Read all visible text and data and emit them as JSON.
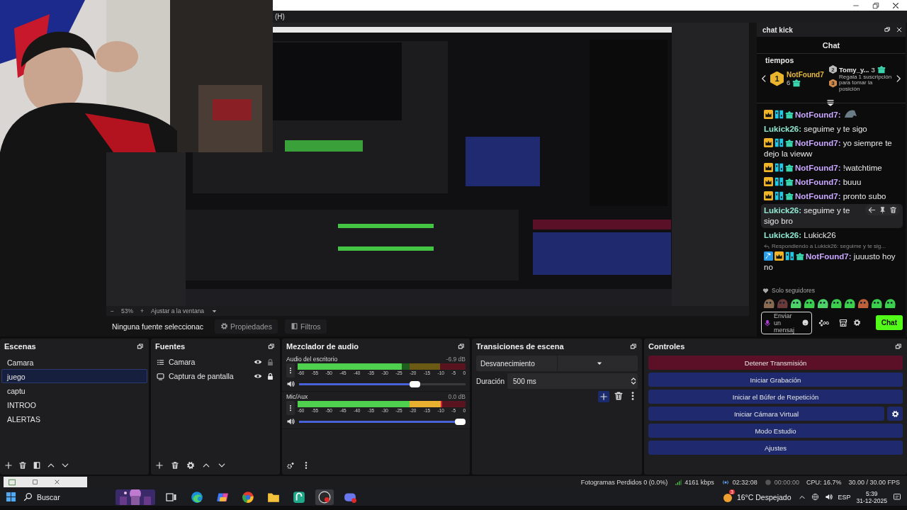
{
  "window": {
    "menu": [
      "(H)"
    ]
  },
  "zoom_bar": {
    "minus": "−",
    "zoom": "53%",
    "plus": "+",
    "fit": "Ajustar a la ventana"
  },
  "source_bar": {
    "status": "Ninguna fuente seleccionac",
    "buttons": [
      {
        "label": "Propiedades",
        "kind": "properties"
      },
      {
        "label": "Filtros",
        "kind": "filters"
      }
    ]
  },
  "chat": {
    "dock_title": "chat kick",
    "title": "Chat",
    "leaderboard": {
      "heading": "tiempos",
      "first": {
        "rank": "1",
        "name": "NotFound7",
        "count": "6"
      },
      "second": {
        "rank": "2",
        "name": "Tomy_y...",
        "count": "3"
      },
      "third": {
        "rank": "3",
        "text": "Regala 1 suscripción para tomar la posición"
      }
    },
    "messages": [
      {
        "kind": "emote",
        "badges": [
          {
            "kind": "crown"
          },
          {
            "kind": "tag"
          },
          {
            "kind": "gift"
          }
        ],
        "user": "NotFound7:",
        "color": "#c9a6ff",
        "selected": false
      },
      {
        "kind": "message",
        "user": "Lukick26:",
        "color": "#8fe6cf",
        "text": "seguime y te sigo",
        "selected": false
      },
      {
        "kind": "message",
        "badges": [
          {
            "kind": "crown"
          },
          {
            "kind": "tag"
          },
          {
            "kind": "gift"
          }
        ],
        "user": "NotFound7:",
        "color": "#c9a6ff",
        "text": "yo siempre te dejo la vieww",
        "selected": false
      },
      {
        "kind": "message",
        "badges": [
          {
            "kind": "crown"
          },
          {
            "kind": "tag"
          },
          {
            "kind": "gift"
          }
        ],
        "user": "NotFound7:",
        "color": "#c9a6ff",
        "text": "!watchtime",
        "selected": false
      },
      {
        "kind": "message",
        "badges": [
          {
            "kind": "crown"
          },
          {
            "kind": "tag"
          },
          {
            "kind": "gift"
          }
        ],
        "user": "NotFound7:",
        "color": "#c9a6ff",
        "text": "buuu",
        "selected": false
      },
      {
        "kind": "message",
        "badges": [
          {
            "kind": "crown"
          },
          {
            "kind": "tag"
          },
          {
            "kind": "gift"
          }
        ],
        "user": "NotFound7:",
        "color": "#c9a6ff",
        "text": "pronto subo",
        "selected": false
      },
      {
        "kind": "message",
        "user": "Lukick26:",
        "color": "#8fe6cf",
        "text": "seguime y te sigo bro",
        "selected": true
      },
      {
        "kind": "message",
        "user": "Lukick26:",
        "color": "#8fe6cf",
        "text": "Lukick26",
        "selected": false
      },
      {
        "kind": "reply",
        "text": "Respondiendo a Lukick26: seguime y te sig...",
        "selected": false
      },
      {
        "kind": "message",
        "badges": [
          {
            "kind": "hammer"
          },
          {
            "kind": "crown"
          },
          {
            "kind": "tag"
          },
          {
            "kind": "gift"
          }
        ],
        "user": "NotFound7:",
        "color": "#c9a6ff",
        "text": "juuusto hoy no",
        "selected": false
      }
    ],
    "mode": "Solo seguidores",
    "emotes": [
      {
        "color": "#8a6a50"
      },
      {
        "color": "#6a3a3a"
      },
      {
        "color": "#4fd16a"
      },
      {
        "color": "#3ccf4e"
      },
      {
        "color": "#4fd16a"
      },
      {
        "color": "#3ccf4e"
      },
      {
        "color": "#3ccf4e"
      },
      {
        "color": "#c0603a"
      },
      {
        "color": "#3ccf4e"
      },
      {
        "color": "#3ccf4e"
      }
    ],
    "input": {
      "placeholder": "Enviar un mensaj"
    },
    "send": "Chat"
  },
  "scenes": {
    "title": "Escenas",
    "items": [
      {
        "label": "Camara",
        "selected": false
      },
      {
        "label": "juego",
        "selected": true
      },
      {
        "label": "captu",
        "selected": false
      },
      {
        "label": "INTROO",
        "selected": false
      },
      {
        "label": "ALERTAS",
        "selected": false
      }
    ]
  },
  "sources": {
    "title": "Fuentes",
    "items": [
      {
        "label": "Camara",
        "kind": "group",
        "visible": true,
        "locked": false
      },
      {
        "label": "Captura de pantalla",
        "kind": "display",
        "visible": true,
        "locked": true
      }
    ]
  },
  "mixer": {
    "title": "Mezclador de audio",
    "channels": [
      {
        "name": "Audio del escritorio",
        "reading": "-6.9 dB",
        "meter": {
          "level": 0.62
        },
        "volume": {
          "level": 0.71
        },
        "scale": [
          "-60",
          "-55",
          "-50",
          "-45",
          "-40",
          "-35",
          "-30",
          "-25",
          "-20",
          "-15",
          "-10",
          "-5",
          "0"
        ]
      },
      {
        "name": "Mic/Aux",
        "reading": "0.0 dB",
        "meter": {
          "level": 0.86
        },
        "volume": {
          "level": 1
        },
        "scale": [
          "-60",
          "-55",
          "-50",
          "-45",
          "-40",
          "-35",
          "-30",
          "-25",
          "-20",
          "-15",
          "-10",
          "-5",
          "0"
        ]
      }
    ]
  },
  "transitions": {
    "title": "Transiciones de escena",
    "transition": "Desvanecimiento",
    "duration_label": "Duración",
    "duration": "500 ms"
  },
  "controls": {
    "title": "Controles",
    "buttons": [
      {
        "label": "Detener Transmisión",
        "active": true,
        "settings": false
      },
      {
        "label": "Iniciar Grabación",
        "active": false,
        "settings": false
      },
      {
        "label": "Iniciar el Búfer de Repetición",
        "active": false,
        "settings": false
      },
      {
        "label": "Iniciar Cámara Virtual",
        "active": false,
        "settings": true
      },
      {
        "label": "Modo Estudio",
        "active": false,
        "settings": false
      },
      {
        "label": "Ajustes",
        "active": false,
        "settings": false
      }
    ]
  },
  "status_bar": {
    "dropped": "Fotogramas Perdidos 0 (0.0%)",
    "bitrate": "4161 kbps",
    "stream_time": "02:32:08",
    "record_time": "00:00:00",
    "cpu": "CPU: 16.7%",
    "fps": "30.00 / 30.00 FPS"
  },
  "taskbar": {
    "search": {
      "placeholder": "Buscar"
    },
    "apps": [
      {
        "kind": "task-view",
        "active": false
      },
      {
        "kind": "edge",
        "active": false
      },
      {
        "kind": "copilot",
        "active": false
      },
      {
        "kind": "chrome",
        "active": false
      },
      {
        "kind": "files",
        "active": false
      },
      {
        "kind": "green",
        "active": false
      },
      {
        "kind": "obs",
        "active": true
      },
      {
        "kind": "discord",
        "active": false
      }
    ],
    "weather": {
      "badge": "3",
      "text": "16°C Despejado"
    },
    "language": "ESP",
    "time": "5:39",
    "date": "31-12-2025"
  }
}
